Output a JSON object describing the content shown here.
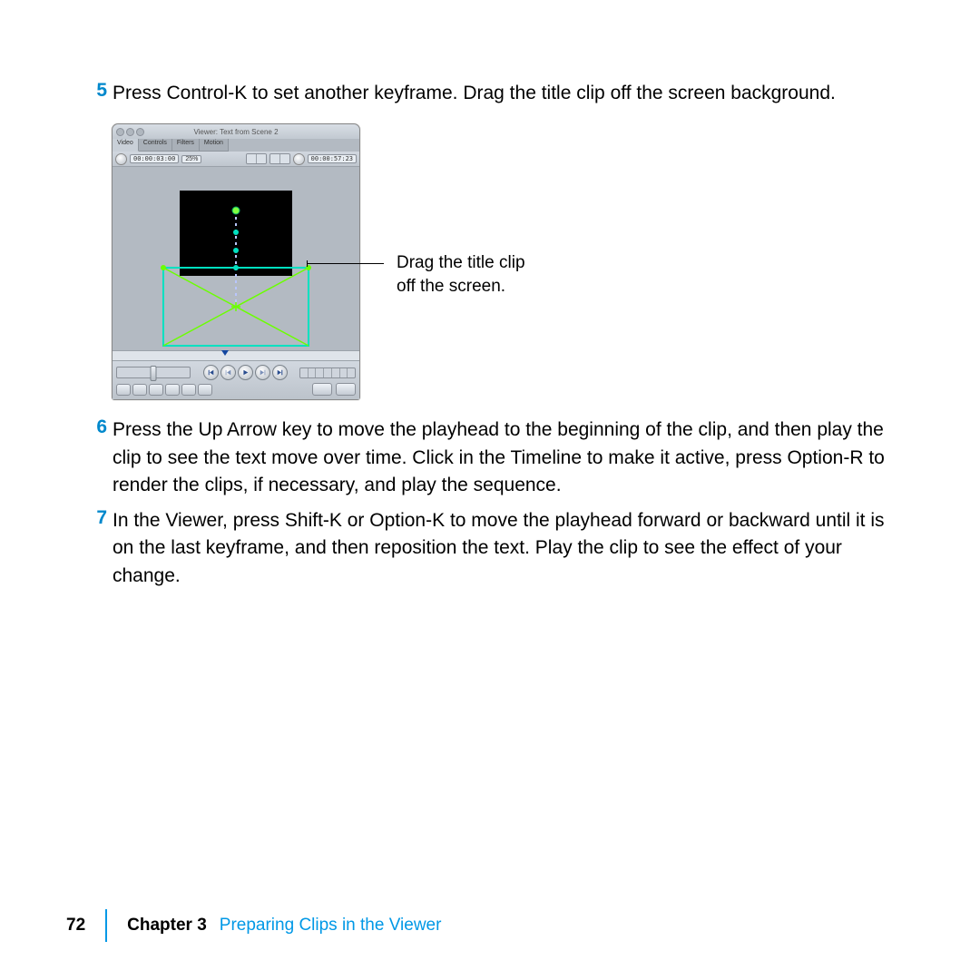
{
  "steps": {
    "s5": {
      "num": "5",
      "text": "Press Control-K to set another keyframe. Drag the title clip off the screen background."
    },
    "s6": {
      "num": "6",
      "text": "Press the Up Arrow key to move the playhead to the beginning of the clip, and then play the clip to see the text move over time. Click in the Timeline to make it active, press Option-R to render the clips, if necessary, and play the sequence."
    },
    "s7": {
      "num": "7",
      "text": "In the Viewer, press Shift-K or Option-K to move the playhead forward or backward until it is on the last keyframe, and then reposition the text. Play the clip to see the effect of your change."
    }
  },
  "viewer": {
    "window_title": "Viewer: Text from Scene 2",
    "tabs": {
      "video": "Video",
      "controls": "Controls",
      "filters": "Filters",
      "motion": "Motion"
    },
    "timecode_in": "00:00:03:00",
    "zoom": "25%",
    "timecode_out": "00:00:57:23"
  },
  "callout": {
    "line1": "Drag the title clip",
    "line2": "off the screen."
  },
  "footer": {
    "page": "72",
    "chapter_label": "Chapter 3",
    "chapter_title": "Preparing Clips in the Viewer"
  }
}
